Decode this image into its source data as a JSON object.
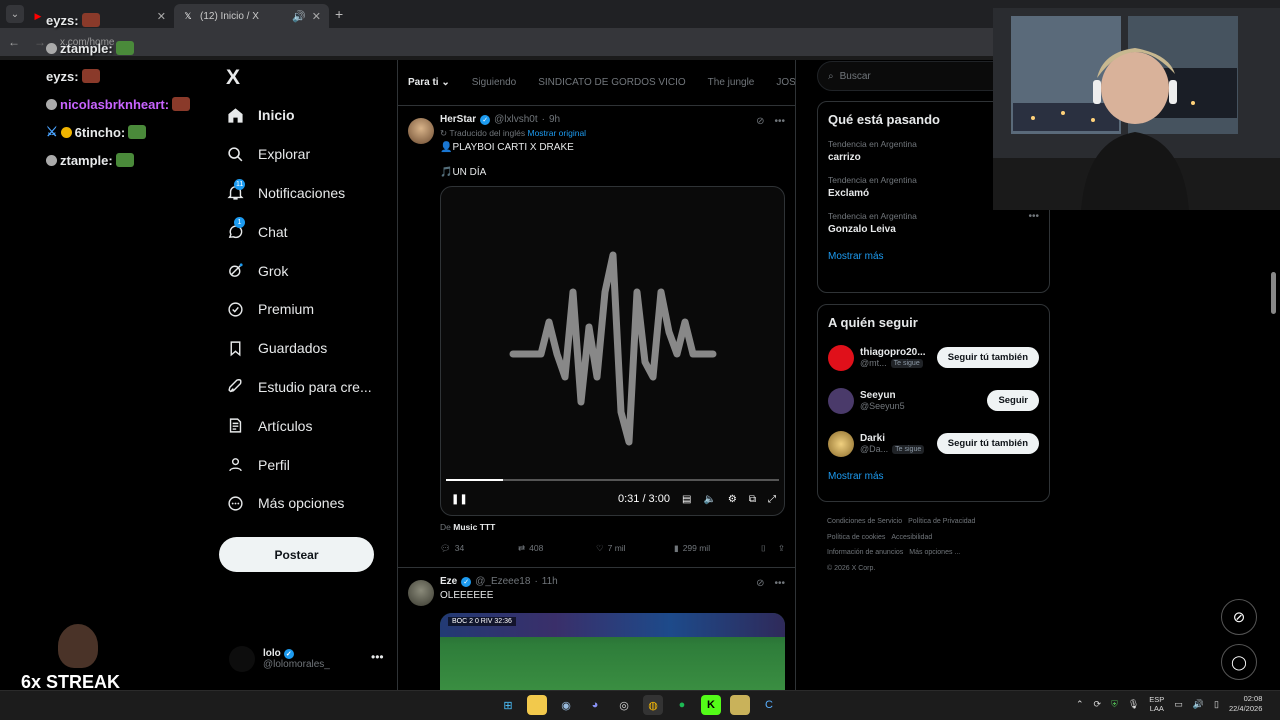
{
  "browser": {
    "tabs": [
      {
        "title": "",
        "active": false
      },
      {
        "title": "(12) Inicio / X",
        "active": true
      }
    ],
    "url": "x.com/home"
  },
  "sidebar": {
    "logo": "X",
    "items": [
      {
        "label": "Inicio",
        "icon": "home-icon",
        "active": true
      },
      {
        "label": "Explorar",
        "icon": "search-icon"
      },
      {
        "label": "Notificaciones",
        "icon": "bell-icon",
        "badge": "11"
      },
      {
        "label": "Chat",
        "icon": "chat-icon",
        "badge": "1"
      },
      {
        "label": "Grok",
        "icon": "grok-icon"
      },
      {
        "label": "Premium",
        "icon": "premium-icon"
      },
      {
        "label": "Guardados",
        "icon": "bookmark-icon"
      },
      {
        "label": "Estudio para cre...",
        "icon": "rocket-icon"
      },
      {
        "label": "Artículos",
        "icon": "article-icon"
      },
      {
        "label": "Perfil",
        "icon": "person-icon"
      },
      {
        "label": "Más opciones",
        "icon": "more-icon"
      }
    ],
    "post_button": "Postear",
    "account": {
      "name": "lolo",
      "handle": "@lolomorales_"
    }
  },
  "feed": {
    "tabs": [
      "Para ti",
      "Siguiendo",
      "SINDICATO DE GORDOS VICIO",
      "The jungle",
      "JOS"
    ],
    "tweets": [
      {
        "name": "HerStar",
        "handle": "@lxlvsh0t",
        "time": "9h",
        "translated": "Traducido del inglés",
        "show_original": "Mostrar original",
        "text1": "👤PLAYBOI CARTI X DRAKE",
        "text2": "🎵UN DÍA",
        "video": {
          "time": "0:31 / 3:00",
          "progress": 0.17
        },
        "source_prefix": "De",
        "source": "Music TTT",
        "stats": {
          "replies": "34",
          "reposts": "408",
          "likes": "7 mil",
          "views": "299 mil"
        }
      },
      {
        "name": "Eze",
        "handle": "@_Ezeee18",
        "time": "11h",
        "text1": "OLEEEEEE",
        "scoreboard": "BOC 2 0 RIV 32:36"
      }
    ]
  },
  "right": {
    "search_placeholder": "Buscar",
    "trends_title": "Qué está pasando",
    "trends": [
      {
        "context": "Tendencia en Argentina",
        "name": "carrizo"
      },
      {
        "context": "Tendencia en Argentina",
        "name": "Exclamó"
      },
      {
        "context": "Tendencia en Argentina",
        "name": "Gonzalo Leiva"
      }
    ],
    "trends_more": "Mostrar más",
    "who_title": "A quién seguir",
    "who": [
      {
        "name": "thiagopro20...",
        "handle": "@mt...",
        "follows_you": "Te sigue",
        "button": "Seguir tú también",
        "color": "#e0101a"
      },
      {
        "name": "Seeyun",
        "handle": "@Seeyun5",
        "follows_you": "",
        "button": "Seguir",
        "color": "#4a3a6a"
      },
      {
        "name": "Darki",
        "handle": "@Da...",
        "follows_you": "Te sigue",
        "button": "Seguir tú también",
        "color": "#caa04a"
      }
    ],
    "who_more": "Mostrar más",
    "footer": [
      "Condiciones de Servicio",
      "Política de Privacidad",
      "Política de cookies",
      "Accesibilidad",
      "Información de anuncios",
      "Más opciones ...",
      "© 2026 X Corp."
    ]
  },
  "stream": {
    "chat": [
      {
        "user": "eyzs:",
        "color": "#ffffff"
      },
      {
        "user": "ztample:",
        "color": "#ffffff"
      },
      {
        "user": "eyzs:",
        "color": "#ffffff"
      },
      {
        "user": "nicolasbrknheart:",
        "color": "#c864ff"
      },
      {
        "user": "6tincho:",
        "color": "#ffffff"
      },
      {
        "user": "ztample:",
        "color": "#ffffff"
      }
    ],
    "streak": "6x STREAK"
  },
  "taskbar": {
    "lang": "ESP",
    "lang2": "LAA",
    "time": "02:08",
    "date": "22/4/2026"
  },
  "colors": {
    "accent": "#1d9bf0",
    "background": "#000000",
    "border": "#2f3336"
  }
}
